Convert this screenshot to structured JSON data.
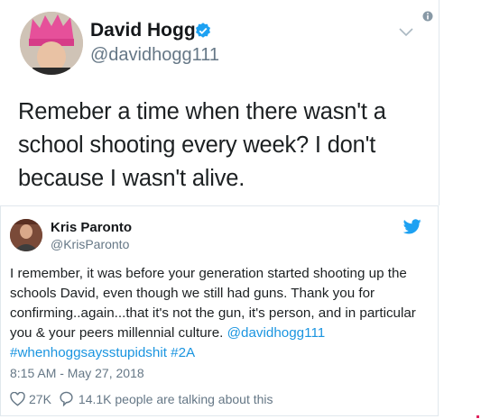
{
  "outer_tweet": {
    "display_name": "David Hogg",
    "handle": "@davidhogg111",
    "text": "Remeber a time when there wasn't a school shooting every week? I don't because I wasn't alive."
  },
  "quote_tweet": {
    "display_name": "Kris Paronto",
    "handle": "@KrisParonto",
    "text_main": "I remember, it was before your generation started shooting up the schools David, even though we still had guns. Thank you for confirming..again...that it's not the gun, it's person, and in particular you & your peers millennial culture.",
    "mention": "@davidhogg111",
    "hashtags": "#whenhoggsaysstupidshit #2A",
    "timestamp": "8:15 AM - May 27, 2018",
    "likes": "27K",
    "conversation": "14.1K people are talking about this"
  },
  "colors": {
    "link": "#1b95e0",
    "verified": "#1da1f2",
    "secondary_text": "#657786"
  },
  "icons": [
    "verified-badge-icon",
    "chevron-down-icon",
    "info-icon",
    "twitter-bird-icon",
    "heart-icon",
    "reply-bubble-icon"
  ]
}
